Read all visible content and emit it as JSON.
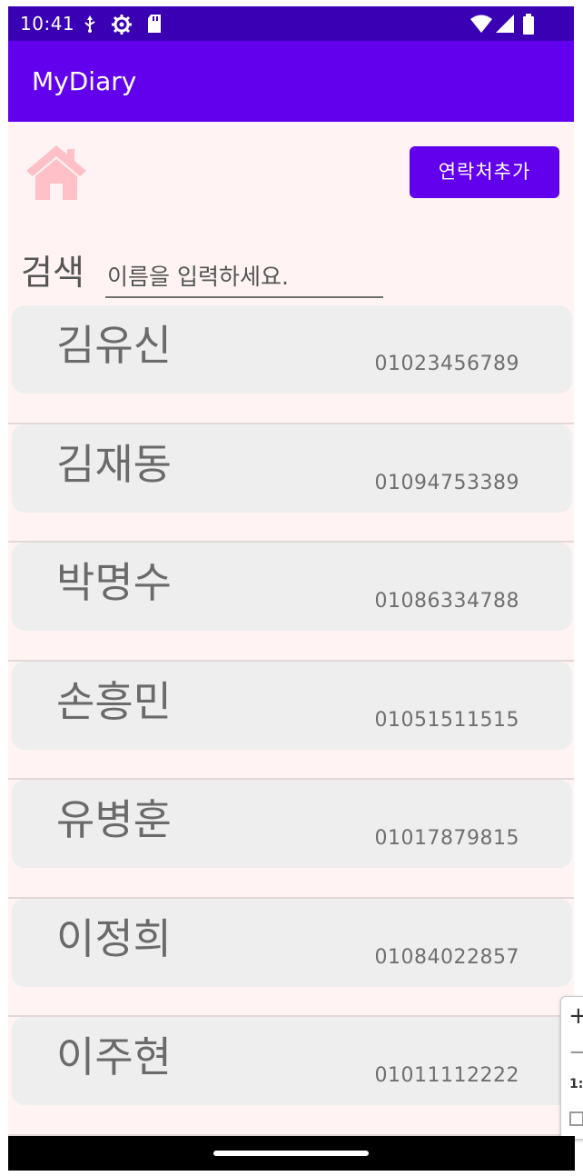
{
  "status_bar": {
    "time": "10:41",
    "icons": [
      "usb-icon",
      "settings-gear-icon",
      "sd-card-icon",
      "wifi-icon",
      "signal-icon",
      "battery-icon"
    ]
  },
  "app_bar": {
    "title": "MyDiary"
  },
  "toolbar": {
    "home_icon": "home-icon",
    "add_contact_label": "연락처추가"
  },
  "search": {
    "label": "검색",
    "placeholder": "이름을 입력하세요.",
    "value": ""
  },
  "contacts": [
    {
      "name": "김유신",
      "phone": "01023456789"
    },
    {
      "name": "김재동",
      "phone": "01094753389"
    },
    {
      "name": "박명수",
      "phone": "01086334788"
    },
    {
      "name": "손흥민",
      "phone": "01051511515"
    },
    {
      "name": "유병훈",
      "phone": "01017879815"
    },
    {
      "name": "이정희",
      "phone": "01084022857"
    },
    {
      "name": "이주현",
      "phone": "01011112222"
    }
  ],
  "zoom_control": {
    "ratio_label": "1:"
  },
  "colors": {
    "primary": "#6200ee",
    "primary_dark": "#3a00b3",
    "home_icon": "#ffc0c8",
    "background": "#fff3f3",
    "card": "#eeeeee"
  }
}
